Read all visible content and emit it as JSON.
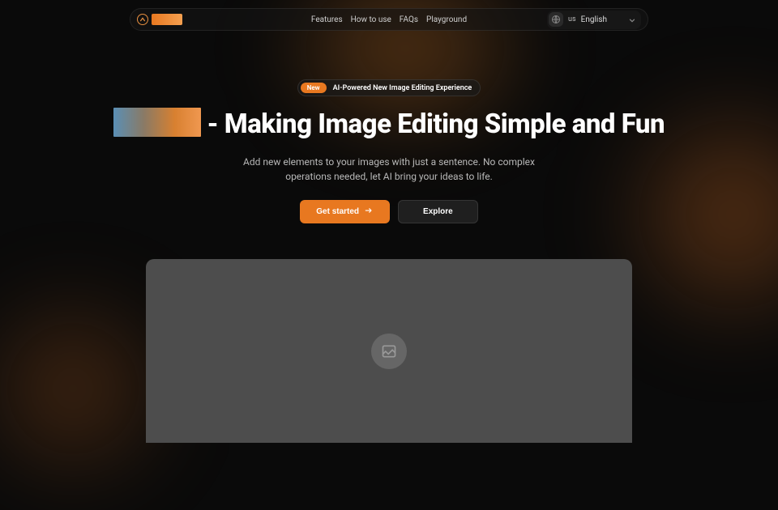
{
  "nav": {
    "links": [
      "Features",
      "How to use",
      "FAQs",
      "Playground"
    ],
    "lang_code": "us",
    "lang_label": "English"
  },
  "hero": {
    "badge_pill": "New",
    "badge_text": "AI-Powered New Image Editing Experience",
    "headline_rest": " - Making Image Editing Simple and Fun",
    "subheadline": "Add new elements to your images with just a sentence. No complex operations needed, let AI bring your ideas to life.",
    "cta_primary": "Get started",
    "cta_secondary": "Explore"
  }
}
